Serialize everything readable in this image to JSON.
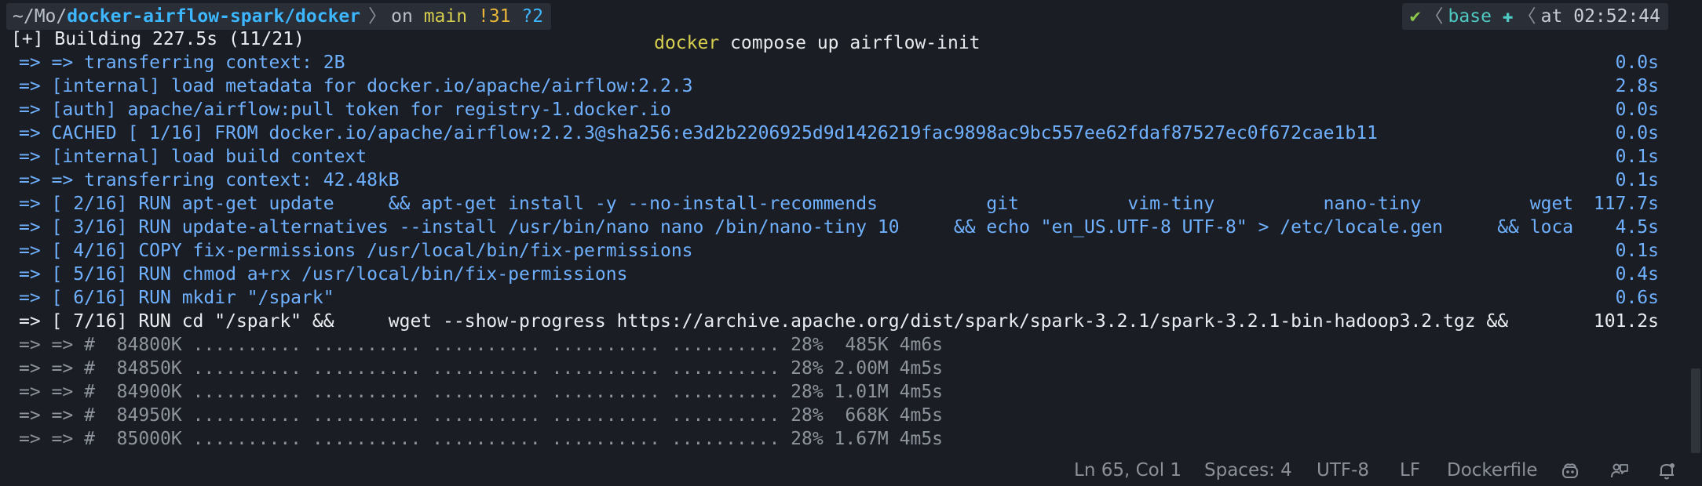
{
  "prompt": {
    "path_prefix": "~/Mo/",
    "path_bold": "docker-airflow-spark/docker",
    "git_on": "on",
    "branch": "main",
    "modified": "!31",
    "untracked": "?2",
    "command_name": "docker",
    "command_args": "compose up airflow-init",
    "status_ok": "✔",
    "conda_env": "base",
    "at_label": "at",
    "time": "02:52:44"
  },
  "build_header": "[+] Building 227.5s (11/21)",
  "build_steps": [
    {
      "text": "=> => transferring context: 2B",
      "time": "0.0s"
    },
    {
      "text": "=> [internal] load metadata for docker.io/apache/airflow:2.2.3",
      "time": "2.8s"
    },
    {
      "text": "=> [auth] apache/airflow:pull token for registry-1.docker.io",
      "time": "0.0s"
    },
    {
      "text": "=> CACHED [ 1/16] FROM docker.io/apache/airflow:2.2.3@sha256:e3d2b2206925d9d1426219fac9898ac9bc557ee62fdaf87527ec0f672cae1b11",
      "time": "0.0s"
    },
    {
      "text": "=> [internal] load build context",
      "time": "0.1s"
    },
    {
      "text": "=> => transferring context: 42.48kB",
      "time": "0.1s"
    },
    {
      "text": "=> [ 2/16] RUN apt-get update     && apt-get install -y --no-install-recommends          git          vim-tiny          nano-tiny          wget",
      "time": "117.7s"
    },
    {
      "text": "=> [ 3/16] RUN update-alternatives --install /usr/bin/nano nano /bin/nano-tiny 10     && echo \"en_US.UTF-8 UTF-8\" > /etc/locale.gen     && loca",
      "time": "4.5s"
    },
    {
      "text": "=> [ 4/16] COPY fix-permissions /usr/local/bin/fix-permissions",
      "time": "0.1s"
    },
    {
      "text": "=> [ 5/16] RUN chmod a+rx /usr/local/bin/fix-permissions",
      "time": "0.4s"
    },
    {
      "text": "=> [ 6/16] RUN mkdir \"/spark\"",
      "time": "0.6s"
    }
  ],
  "active_step": {
    "text": "=> [ 7/16] RUN cd \"/spark\" &&     wget --show-progress https://archive.apache.org/dist/spark/spark-3.2.1/spark-3.2.1-bin-hadoop3.2.tgz &&",
    "time": "101.2s"
  },
  "progress_lines": [
    "=> => #  84800K .......... .......... .......... .......... .......... 28%  485K 4m6s",
    "=> => #  84850K .......... .......... .......... .......... .......... 28% 2.00M 4m5s",
    "=> => #  84900K .......... .......... .......... .......... .......... 28% 1.01M 4m5s",
    "=> => #  84950K .......... .......... .......... .......... .......... 28%  668K 4m5s",
    "=> => #  85000K .......... .......... .......... .......... .......... 28% 1.67M 4m5s"
  ],
  "statusbar": {
    "position": "Ln 65, Col 1",
    "spaces": "Spaces: 4",
    "encoding": "UTF-8",
    "eol": "LF",
    "language": "Dockerfile"
  },
  "colors": {
    "background": "#1a1d23",
    "step_blue": "#6fb0ff",
    "active_white": "#e9ecf0",
    "progress_grey": "#8e949c"
  }
}
